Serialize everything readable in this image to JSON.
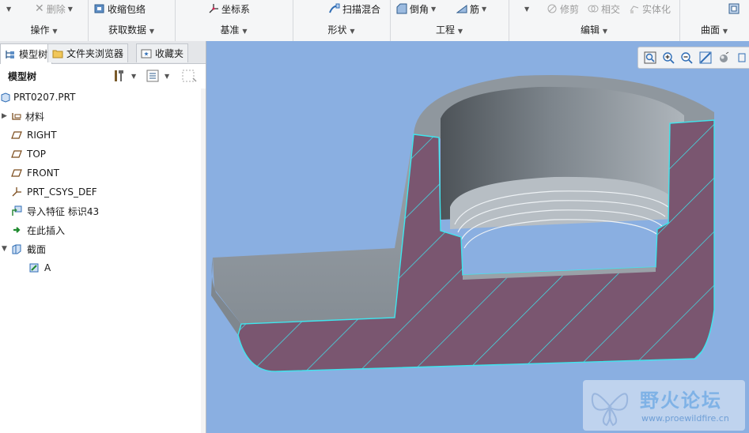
{
  "ribbon": {
    "groups": [
      {
        "label": "操作",
        "commands": [
          "删除"
        ]
      },
      {
        "label": "获取数据",
        "commands": [
          "收缩包络"
        ]
      },
      {
        "label": "基准",
        "commands": [
          "坐标系"
        ]
      },
      {
        "label": "形状",
        "commands": [
          "扫描混合"
        ]
      },
      {
        "label": "工程",
        "commands": [
          "倒角",
          "筋"
        ]
      },
      {
        "label": "编辑",
        "commands": [
          "修剪",
          "相交",
          "实体化"
        ]
      },
      {
        "label": "曲面",
        "commands": []
      }
    ]
  },
  "panel": {
    "tabs": [
      "模型树",
      "文件夹浏览器",
      "收藏夹"
    ],
    "tree_title": "模型树",
    "items": [
      "PRT0207.PRT",
      "材料",
      "RIGHT",
      "TOP",
      "FRONT",
      "PRT_CSYS_DEF",
      "导入特征 标识43",
      "在此插入",
      "截面",
      "A"
    ]
  },
  "watermark": {
    "title": "野火论坛",
    "url": "www.proewildfire.cn"
  },
  "colors": {
    "viewport_bg": "#8aafe1",
    "section_fill": "#7a5670",
    "hatch": "#3ee6ee",
    "model_gray": "#9aa1a8"
  }
}
